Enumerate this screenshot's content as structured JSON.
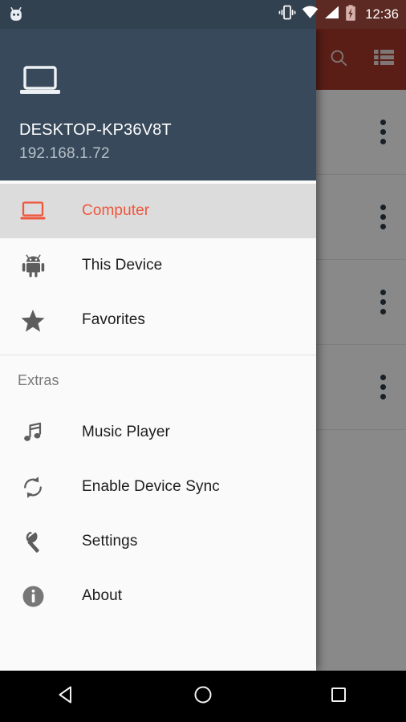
{
  "status_bar": {
    "app_icon": "android-marshmallow-icon",
    "icons": [
      "vibrate-icon",
      "wifi-icon",
      "cellular-signal-icon",
      "battery-charging-icon"
    ],
    "clock": "12:36",
    "left_bg": "#31414f",
    "right_bg": "#5c2a22"
  },
  "app_bar": {
    "bg": "#a5372a",
    "actions": [
      {
        "name": "search-button",
        "icon": "search-icon"
      },
      {
        "name": "view-list-button",
        "icon": "list-view-icon"
      }
    ]
  },
  "content": {
    "rows": [
      {
        "overflow": "more-options-icon"
      },
      {
        "overflow": "more-options-icon"
      },
      {
        "overflow": "more-options-icon"
      },
      {
        "overflow": "more-options-icon"
      }
    ]
  },
  "drawer": {
    "header": {
      "icon": "laptop-icon",
      "title": "DESKTOP-KP36V8T",
      "subtitle": "192.168.1.72",
      "bg": "#37495a"
    },
    "accent_color": "#f0563c",
    "selected_bg": "#dcdcdc",
    "items": [
      {
        "label": "Computer",
        "icon": "laptop-icon",
        "selected": true
      },
      {
        "label": "This Device",
        "icon": "android-icon",
        "selected": false
      },
      {
        "label": "Favorites",
        "icon": "star-icon",
        "selected": false
      }
    ],
    "section_title": "Extras",
    "extras": [
      {
        "label": "Music Player",
        "icon": "music-note-icon"
      },
      {
        "label": "Enable Device Sync",
        "icon": "sync-icon"
      },
      {
        "label": "Settings",
        "icon": "wrench-icon"
      },
      {
        "label": "About",
        "icon": "info-icon"
      }
    ]
  },
  "nav_bar": {
    "buttons": [
      {
        "name": "back-button",
        "icon": "back-triangle-icon"
      },
      {
        "name": "home-button",
        "icon": "home-circle-icon"
      },
      {
        "name": "recents-button",
        "icon": "recents-square-icon"
      }
    ]
  }
}
